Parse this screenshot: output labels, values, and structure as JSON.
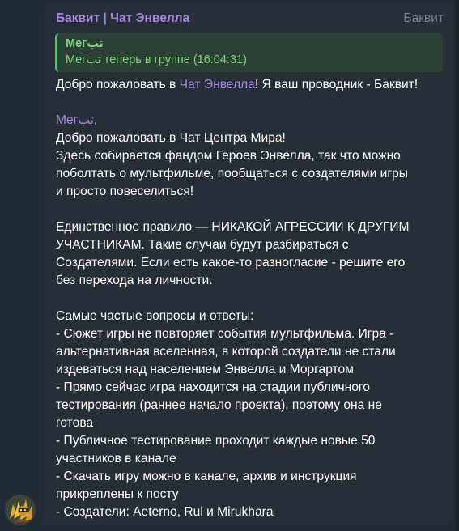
{
  "message": {
    "sender": "Баквит | Чат Энвелла",
    "via": "Баквит",
    "reply": {
      "author": "Mегتب",
      "text": "Mегتب теперь в группе (16:04:31)"
    },
    "welcome": {
      "prefix": "Добро пожаловать в ",
      "chat_link": "Чат Энвелла",
      "suffix": "! Я ваш проводник - Баквит!"
    },
    "mention": {
      "name": "Mегتب",
      "suffix": ","
    },
    "lines": {
      "l1": "Добро пожаловать в Чат Центра Мира!",
      "l2": "Здесь собирается фандом Героев Энвелла, так что можно",
      "l3": "поболтать о мультфильме, пообщаться с создателями игры",
      "l4": "и просто повеселиться!",
      "r1": "Единственное правило — НИКАКОЙ АГРЕССИИ К ДРУГИМ",
      "r2": "УЧАСТНИКАМ. Такие случаи будут разбираться с",
      "r3": "Создателями. Если есть какое-то разногласие - решите его",
      "r4": "без перехода на личности.",
      "f0": "Самые частые вопросы и ответы:",
      "f1": "- Сюжет игры не повторяет события мультфильма. Игра -",
      "f2": "альтернативная вселенная, в которой создатели не стали",
      "f3": "издеваться над населением Энвелла и Моргартом",
      "f4": "- Прямо сейчас игра находится на стадии публичного",
      "f5": "тестирования (раннее начало проекта), поэтому она не",
      "f6": "готова",
      "f7": "- Публичное тестирование проходит каждые новые 50",
      "f8": "участников в канале",
      "f9": "- Скачать игру можно в канале, архив и инструкция",
      "f10": "прикреплены к посту",
      "f11": "- Создатели: Aeterno, Rul и Mirukhara"
    }
  },
  "colors": {
    "background": "#202b36",
    "bubble": "#262f38",
    "accent_purple": "#a586df",
    "reply_green": "#7fd47e",
    "reply_bg": "#2d4035",
    "text": "#ffffff",
    "muted": "#75808c"
  },
  "avatar": {
    "icon": "bot-avatar-icon"
  }
}
